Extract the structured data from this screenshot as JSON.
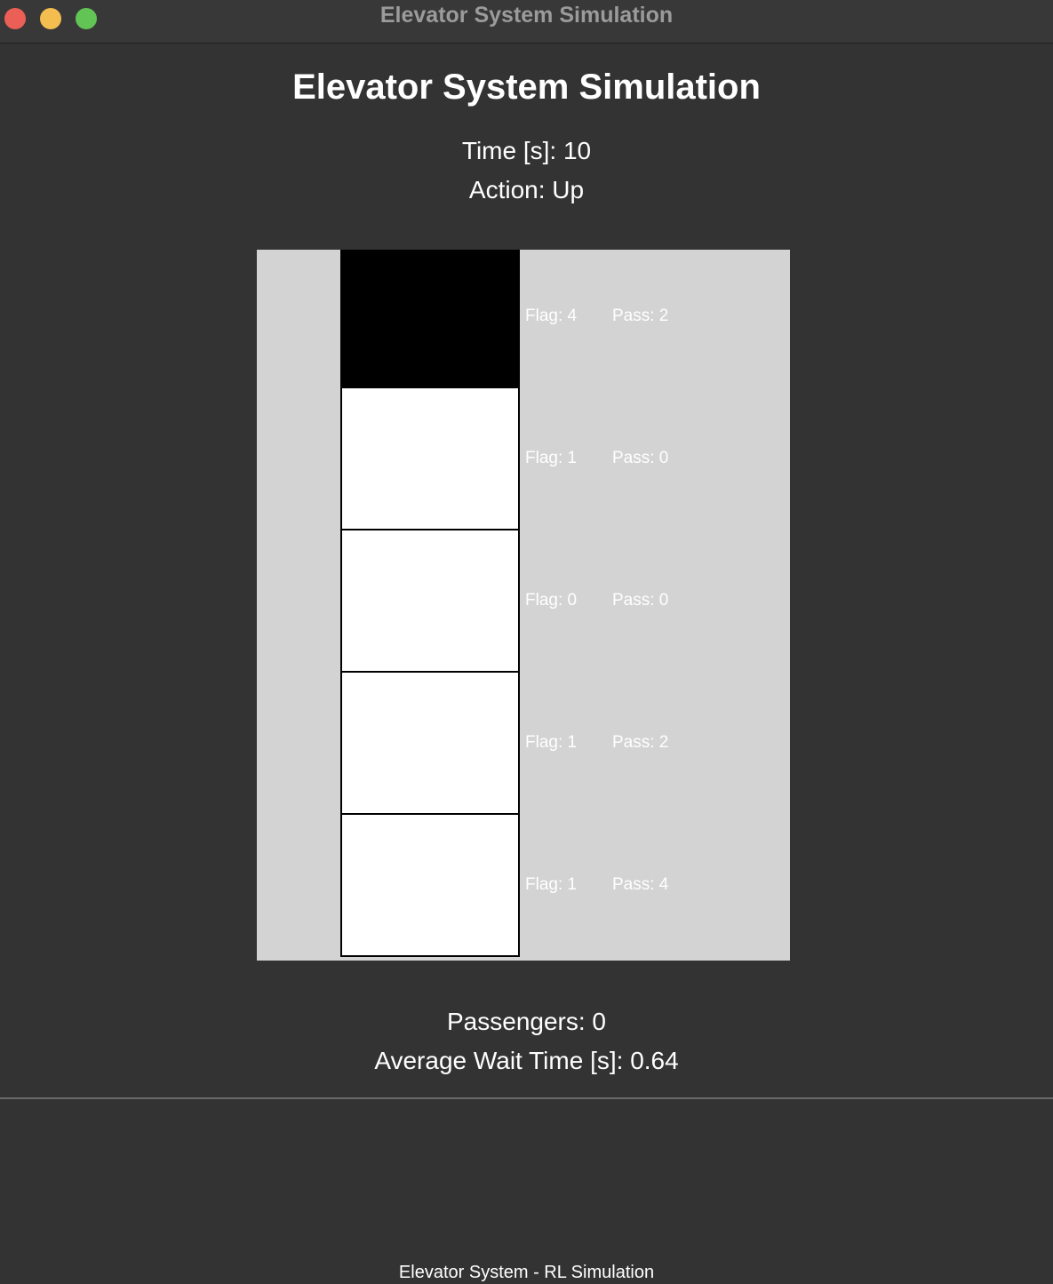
{
  "window": {
    "title": "Elevator System Simulation"
  },
  "main": {
    "title": "Elevator System Simulation",
    "time": "Time [s]: 10",
    "action": "Action: Up"
  },
  "floors": [
    {
      "flag": "Flag: 4",
      "pass": "Pass: 2",
      "elevator_here": true
    },
    {
      "flag": "Flag: 1",
      "pass": "Pass: 0",
      "elevator_here": false
    },
    {
      "flag": "Flag: 0",
      "pass": "Pass: 0",
      "elevator_here": false
    },
    {
      "flag": "Flag: 1",
      "pass": "Pass: 2",
      "elevator_here": false
    },
    {
      "flag": "Flag: 1",
      "pass": "Pass: 4",
      "elevator_here": false
    }
  ],
  "stats": {
    "passengers": "Passengers: 0",
    "avg_wait": "Average Wait Time [s]: 0.64"
  },
  "footer": {
    "text": "Elevator System - RL Simulation"
  },
  "colors": {
    "background": "#333333",
    "canvas": "#d3d3d3",
    "elevator_car": "#000000",
    "floor": "#ffffff",
    "close_button": "#ec5f57",
    "minimize_button": "#f4bd4f",
    "maximize_button": "#61c455"
  }
}
